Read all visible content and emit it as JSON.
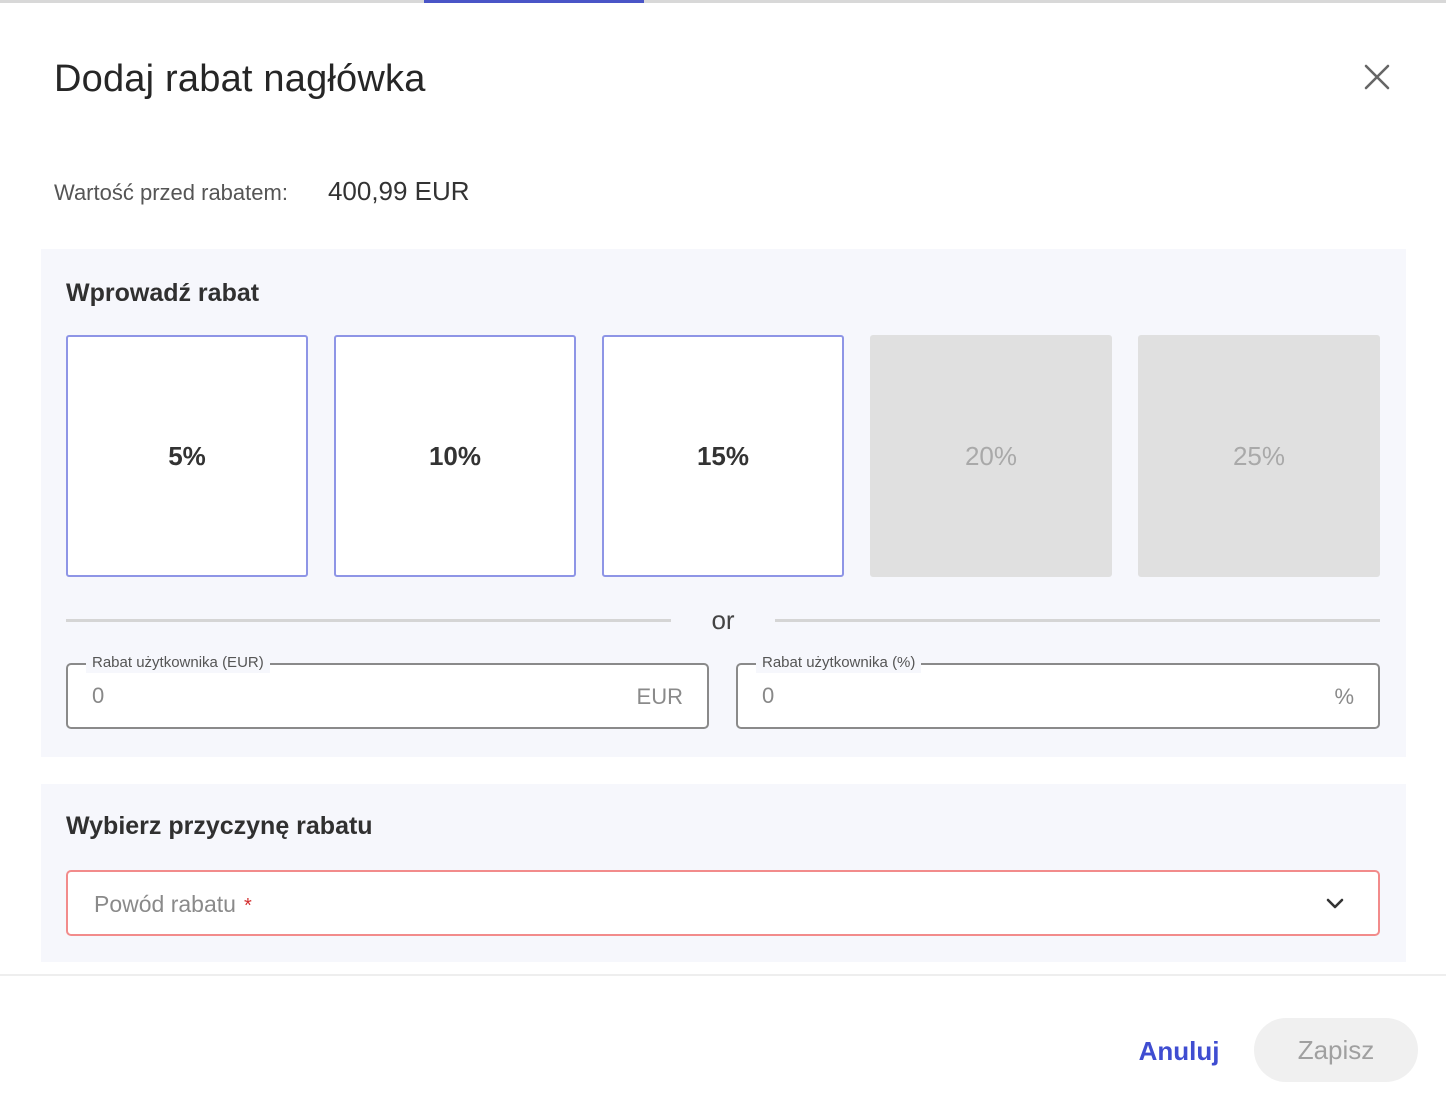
{
  "dialog": {
    "title": "Dodaj rabat nagłówka",
    "close_icon": "close-icon"
  },
  "value_before": {
    "label": "Wartość przed rabatem:",
    "amount": "400,99 EUR"
  },
  "discount_section": {
    "title": "Wprowadź rabat",
    "presets": [
      {
        "label": "5%",
        "enabled": true
      },
      {
        "label": "10%",
        "enabled": true
      },
      {
        "label": "15%",
        "enabled": true
      },
      {
        "label": "20%",
        "enabled": false
      },
      {
        "label": "25%",
        "enabled": false
      }
    ],
    "divider_text": "or",
    "eur_field": {
      "label": "Rabat użytkownika (EUR)",
      "value": "0",
      "suffix": "EUR"
    },
    "pct_field": {
      "label": "Rabat użytkownika (%)",
      "value": "0",
      "suffix": "%"
    }
  },
  "reason_section": {
    "title": "Wybierz przyczynę rabatu",
    "select": {
      "placeholder": "Powód rabatu",
      "required_mark": "*",
      "icon": "chevron-down-icon"
    }
  },
  "footer": {
    "cancel_label": "Anuluj",
    "save_label": "Zapisz"
  },
  "colors": {
    "accent": "#3f4dd1",
    "preset_border": "#8e95e6",
    "error_border": "#f28b8b",
    "panel_bg": "#f6f7fc"
  }
}
